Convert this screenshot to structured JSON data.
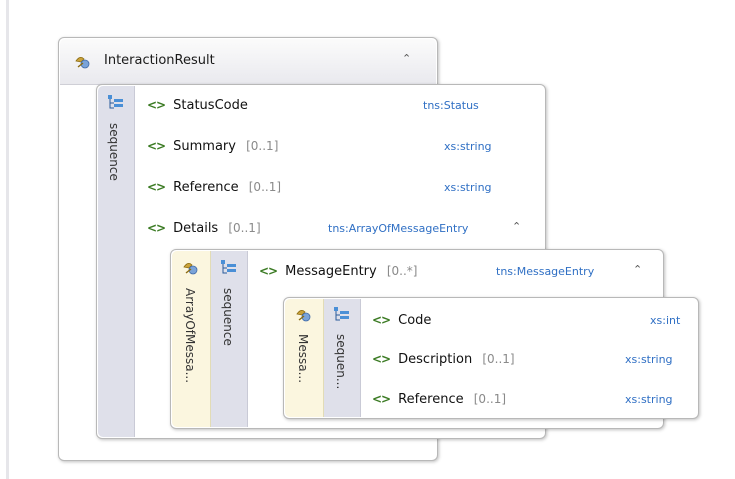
{
  "root": {
    "title": "InteractionResult",
    "sequence_label": "sequence",
    "elements": [
      {
        "name": "StatusCode",
        "occurs": "",
        "type": "tns:Status"
      },
      {
        "name": "Summary",
        "occurs": "[0..1]",
        "type": "xs:string"
      },
      {
        "name": "Reference",
        "occurs": "[0..1]",
        "type": "xs:string"
      },
      {
        "name": "Details",
        "occurs": "[0..1]",
        "type": "tns:ArrayOfMessageEntry"
      }
    ]
  },
  "array_type": {
    "label": "ArrayOfMessa...",
    "sequence_label": "sequence",
    "element": {
      "name": "MessageEntry",
      "occurs": "[0..*]",
      "type": "tns:MessageEntry"
    }
  },
  "message_type": {
    "label": "Messa...",
    "sequence_label": "sequen...",
    "elements": [
      {
        "name": "Code",
        "occurs": "",
        "type": "xs:int"
      },
      {
        "name": "Description",
        "occurs": "[0..1]",
        "type": "xs:string"
      },
      {
        "name": "Reference",
        "occurs": "[0..1]",
        "type": "xs:string"
      }
    ]
  },
  "icons": {
    "complex_type": "complex-type-icon",
    "sequence": "sequence-icon",
    "element": "element-icon",
    "collapse": "double-chevron-up-icon"
  },
  "colors": {
    "type_text": "#2f6fc4",
    "element_icon": "#3a7a22",
    "yellow_bar": "#fbf6df",
    "gray_bar": "#dfe0ea"
  }
}
